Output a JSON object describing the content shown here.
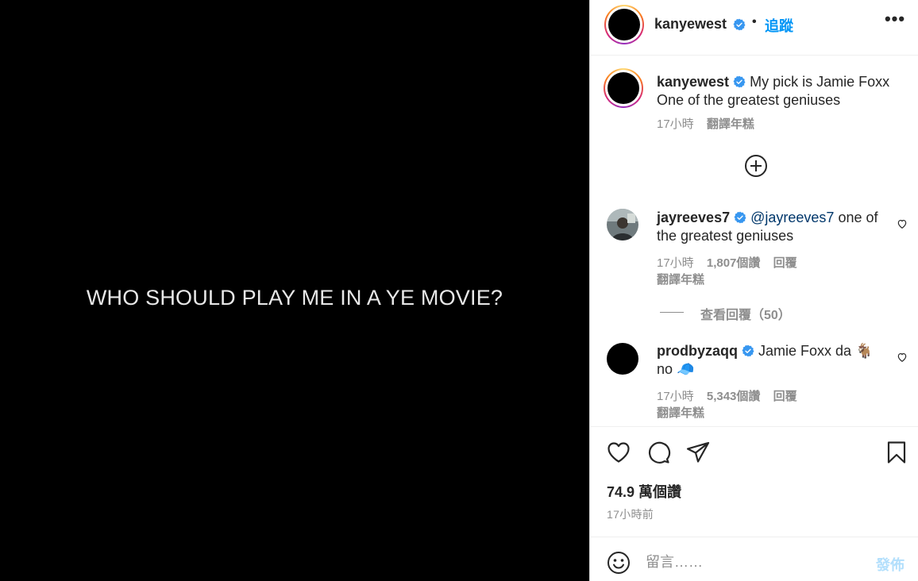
{
  "media": {
    "text": "WHO SHOULD PLAY ME IN A YE MOVIE?"
  },
  "header": {
    "username": "kanyewest",
    "dot": "•",
    "follow_label": "追蹤",
    "more_label": "•••"
  },
  "caption": {
    "username": "kanyewest",
    "text": " My pick is Jamie Foxx One of the greatest geniuses",
    "time": "17小時",
    "translate": "翻譯年糕"
  },
  "comments": [
    {
      "username": "jayreeves7",
      "mention": "@jayreeves7",
      "text": " one of the greatest geniuses",
      "time": "17小時",
      "likes": "1,807個讚",
      "reply": "回覆",
      "translate": "翻譯年糕",
      "view_replies": "查看回覆（50）"
    },
    {
      "username": "prodbyzaqq",
      "text": " Jamie Foxx da 🐐 no 🧢",
      "time": "17小時",
      "likes": "5,343個讚",
      "reply": "回覆",
      "translate": "翻譯年糕"
    }
  ],
  "stats": {
    "likes": "74.9 萬個讚",
    "time_ago": "17小時前"
  },
  "composer": {
    "placeholder": "留言……",
    "post_label": "發佈"
  },
  "colors": {
    "accent": "#0095f6",
    "verified": "#3897f0",
    "muted": "#8e8e8e",
    "post_disabled": "#b2dffc"
  }
}
